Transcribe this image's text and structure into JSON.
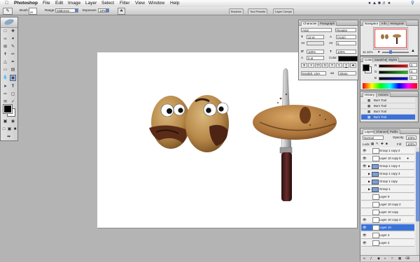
{
  "menubar": {
    "app": "Photoshop",
    "menus": [
      "File",
      "Edit",
      "Image",
      "Layer",
      "Select",
      "Filter",
      "View",
      "Window",
      "Help"
    ]
  },
  "options": {
    "brush_label": "Brush:",
    "brush_size": "65",
    "range_label": "Range:",
    "range_value": "Midtones",
    "exposure_label": "Exposure:",
    "exposure_value": "18%"
  },
  "well_tabs": [
    "Brushes",
    "Tool Presets",
    "Layer Comps"
  ],
  "character": {
    "tabs": [
      "Character",
      "Paragraph"
    ],
    "font": "Arial",
    "style": "Regular",
    "size": "12 pt",
    "leading": "(Auto)",
    "kerning": "",
    "tracking": "0",
    "vscale": "100%",
    "hscale": "100%",
    "baseline": "0 pt",
    "color_label": "Color:",
    "language": "English: USA",
    "aa_label": "aa",
    "aa": "Sharp",
    "style_buttons": [
      "T",
      "T",
      "TT",
      "Tr",
      "T'",
      "T,",
      "T",
      "T"
    ]
  },
  "navigator": {
    "tabs": [
      "Navigator",
      "Info",
      "Histogram"
    ],
    "zoom": "11.11%"
  },
  "color": {
    "tabs": [
      "Color",
      "Swatches",
      "Styles"
    ],
    "channels": [
      {
        "label": "R",
        "value": "0"
      },
      {
        "label": "G",
        "value": "0"
      },
      {
        "label": "B",
        "value": "0"
      }
    ]
  },
  "history": {
    "tabs": [
      "History",
      "Actions"
    ],
    "items": [
      "Burn Tool",
      "Burn Tool",
      "Burn Tool",
      "Burn Tool"
    ],
    "selected_index": 3
  },
  "layers": {
    "tabs": [
      "Layers",
      "Channels",
      "Paths"
    ],
    "blend": "Normal",
    "opacity_label": "Opacity:",
    "opacity": "100%",
    "lock_label": "Lock:",
    "fill_label": "Fill:",
    "fill": "100%",
    "rows": [
      {
        "name": "Group 1 copy 2",
        "kind": "layer",
        "visible": true
      },
      {
        "name": "Layer 10 copy 5",
        "kind": "layer",
        "visible": true,
        "locked": true
      },
      {
        "name": "Group 1 copy 4",
        "kind": "group",
        "visible": true
      },
      {
        "name": "Group 1 copy 3",
        "kind": "group",
        "visible": false
      },
      {
        "name": "Group 1 copy",
        "kind": "group",
        "visible": false
      },
      {
        "name": "Group 1",
        "kind": "group",
        "visible": false
      },
      {
        "name": "Layer 9",
        "kind": "layer",
        "visible": false
      },
      {
        "name": "Layer 10 copy 2",
        "kind": "layer",
        "visible": false
      },
      {
        "name": "Layer 10 copy",
        "kind": "layer",
        "visible": false
      },
      {
        "name": "Layer 10 copy 4",
        "kind": "layer",
        "visible": true
      },
      {
        "name": "Layer 10",
        "kind": "layer",
        "visible": true,
        "selected": true
      },
      {
        "name": "Layer 4",
        "kind": "layer",
        "visible": true
      },
      {
        "name": "Layer 2",
        "kind": "layer",
        "visible": true
      }
    ]
  },
  "colors": {
    "accent": "#3b72d9",
    "canvas": "#ffffff",
    "workspace": "#b4b4b4"
  }
}
